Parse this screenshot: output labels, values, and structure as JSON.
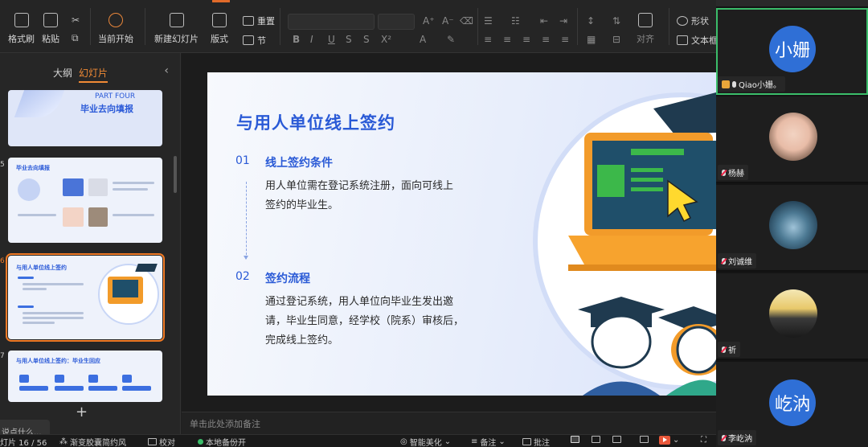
{
  "ribbon": {
    "format_painter": "格式刷",
    "paste": "粘贴",
    "start_from_current": "当前开始",
    "new_slide": "新建幻灯片",
    "layout": "版式",
    "reset": "重置",
    "section": "节",
    "shape": "形状",
    "textbox": "文本框",
    "align": "对齐"
  },
  "left_panel": {
    "tab_outline": "大纲",
    "tab_slides": "幻灯片",
    "thumbs": [
      {
        "num": "",
        "title_top": "PART FOUR",
        "title": "毕业去向填报"
      },
      {
        "num": "5",
        "title": "毕业去向填报"
      },
      {
        "num": "6",
        "title": "与用人单位线上签约"
      },
      {
        "num": "7",
        "title": "与用人单位线上签约：毕业生回应"
      }
    ],
    "notes_tip": "说点什么..."
  },
  "slide": {
    "title": "与用人单位线上签约",
    "items": [
      {
        "num": "01",
        "heading": "线上签约条件",
        "lines": [
          "用人单位需在登记系统注册，面向可线上",
          "签约的毕业生。"
        ]
      },
      {
        "num": "02",
        "heading": "签约流程",
        "lines": [
          "通过登记系统，用人单位向毕业生发出邀",
          "请，毕业生同意，经学校（院系）审核后，",
          "完成线上签约。"
        ]
      }
    ]
  },
  "notes_placeholder": "单击此处添加备注",
  "status": {
    "slide_counter": "灯片 16 / 56",
    "theme": "渐变胶囊简约风",
    "proofread": "校对",
    "backup": "本地备份开",
    "beautify": "智能美化",
    "notes": "备注",
    "comments": "批注"
  },
  "participants": [
    {
      "name": "Qiao小姗。",
      "avatar_text": "小姗",
      "host": true,
      "mic": "on"
    },
    {
      "name": "杨赫",
      "avatar_text": "",
      "mic": "muted"
    },
    {
      "name": "刘诚维",
      "avatar_text": "",
      "mic": "muted"
    },
    {
      "name": "祈",
      "avatar_text": "",
      "mic": "muted"
    },
    {
      "name": "李屹汭",
      "avatar_text": "屹汭",
      "mic": "muted"
    }
  ],
  "colors": {
    "accent": "#f08a35",
    "slide_blue": "#2a5ad6",
    "active_speaker": "#3bbd6a"
  }
}
